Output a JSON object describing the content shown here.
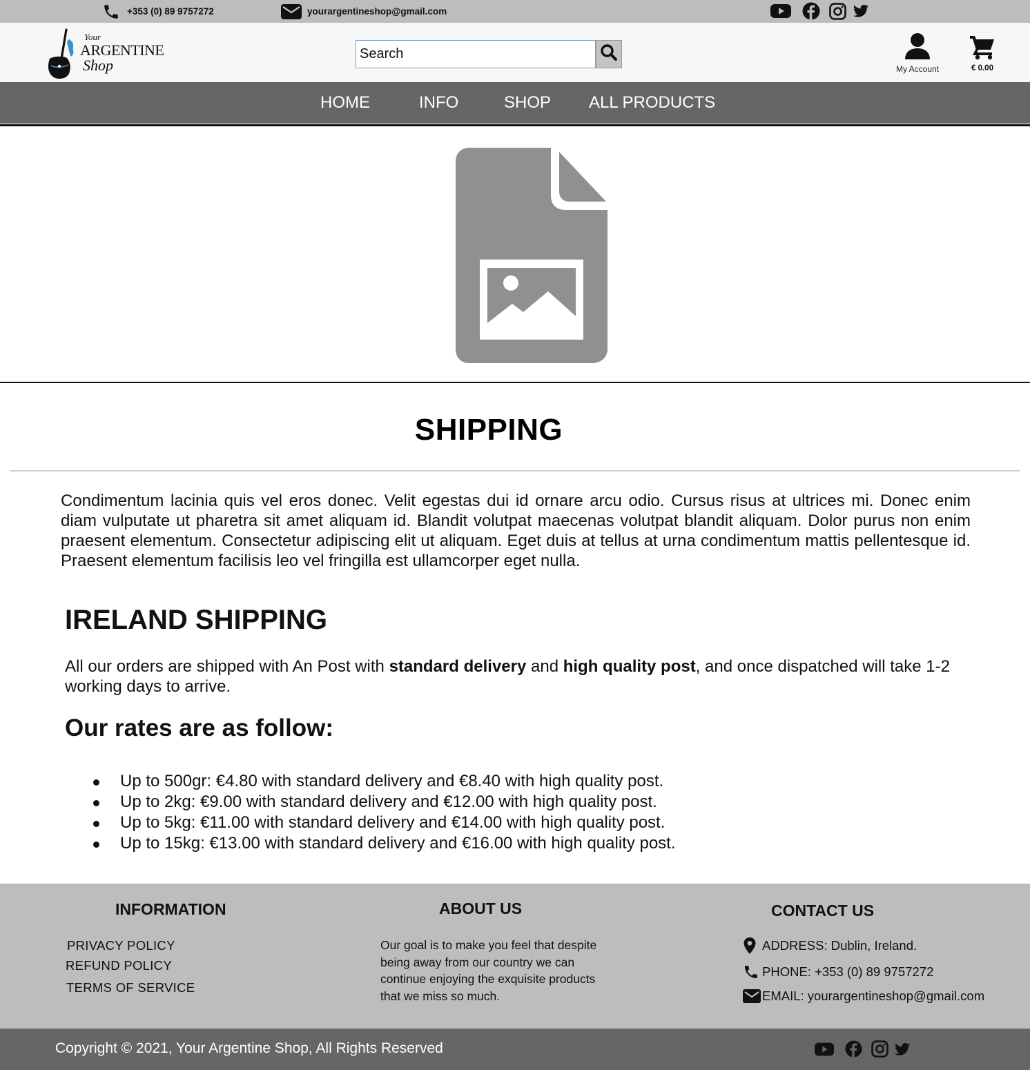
{
  "topbar": {
    "phone": "+353 (0) 89 9757272",
    "email": "yourargentineshop@gmail.com",
    "social_icons": [
      "youtube-icon",
      "facebook-icon",
      "instagram-icon",
      "twitter-icon"
    ]
  },
  "header": {
    "logo": {
      "line1": "Your",
      "line2": "ARGENTINE",
      "line3": "Shop"
    },
    "search": {
      "placeholder": "Search"
    },
    "account_label": "My Account",
    "cart_total": "€ 0.00"
  },
  "nav": {
    "items": [
      {
        "label": "HOME"
      },
      {
        "label": "INFO"
      },
      {
        "label": "SHOP"
      },
      {
        "label": "ALL PRODUCTS"
      }
    ]
  },
  "main": {
    "title": "SHIPPING",
    "intro": "Condimentum lacinia quis vel eros donec. Velit egestas dui id ornare arcu odio. Cursus risus at ultrices mi. Donec enim diam vulputate ut pharetra sit amet aliquam id. Blandit volutpat maecenas volutpat blandit aliquam. Dolor purus non enim praesent elementum. Consectetur adipiscing elit ut aliquam. Eget duis at tellus at urna condimentum mattis pellentesque id. Praesent elementum facilisis leo vel fringilla est ullamcorper eget nulla.",
    "ireland_heading": "IRELAND SHIPPING",
    "shipping_text": {
      "part1": "All our orders are shipped with An Post with ",
      "bold1": "standard delivery",
      "part2": " and ",
      "bold2": "high quality post",
      "part3": ", and once dispatched will take 1-2 working days to arrive."
    },
    "rates_heading": "Our rates are as follow:",
    "rates": [
      "Up to 500gr:  €4.80 with standard delivery and €8.40 with high quality post.",
      "Up to 2kg:  €9.00 with standard delivery and €12.00 with high quality post.",
      "Up to 5kg: €11.00 with standard delivery and €14.00 with high quality post.",
      "Up to 15kg: €13.00 with standard delivery and €16.00 with high quality post."
    ]
  },
  "footer": {
    "information": {
      "heading": "INFORMATION",
      "links": [
        "PRIVACY POLICY",
        "REFUND POLICY",
        "TERMS OF SERVICE"
      ]
    },
    "about": {
      "heading": "ABOUT US",
      "text": "Our goal is to make you feel that despite being away from our country we can continue enjoying the exquisite products that we miss so much."
    },
    "contact": {
      "heading": "CONTACT US",
      "address": "ADDRESS: Dublin, Ireland.",
      "phone": "PHONE: +353 (0) 89 9757272",
      "email": "EMAIL: yourargentineshop@gmail.com"
    },
    "copyright": "Copyright © 2021, Your Argentine Shop, All Rights Reserved"
  },
  "colors": {
    "topbar_bg": "#bdbdbd",
    "nav_bg": "#666666",
    "footer_bg": "#bdbdbd",
    "placeholder_gray": "#909090",
    "logo_accent": "#3a8fc4"
  }
}
